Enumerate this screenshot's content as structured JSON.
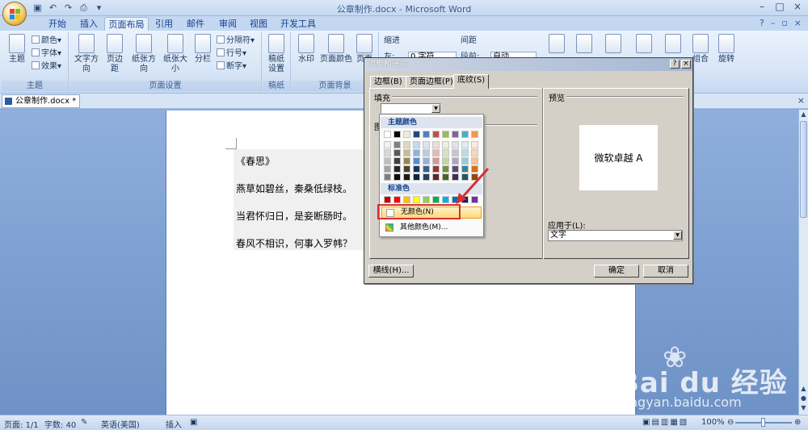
{
  "window": {
    "title": "公章制作.docx - Microsoft Word"
  },
  "ribbon_tabs": [
    "开始",
    "插入",
    "页面布局",
    "引用",
    "邮件",
    "审阅",
    "视图",
    "开发工具"
  ],
  "active_tab": "页面布局",
  "ribbon": {
    "theme": {
      "big": "主题",
      "items": [
        "颜色",
        "字体",
        "效果"
      ],
      "label": "主题"
    },
    "page_setup": {
      "big": [
        "文字方向",
        "页边距",
        "纸张方向",
        "纸张大小",
        "分栏"
      ],
      "items": [
        "分隔符",
        "行号",
        "断字"
      ],
      "label": "页面设置"
    },
    "paper": {
      "big": [
        "稿纸",
        "设置"
      ],
      "label": "稿纸"
    },
    "page_background": {
      "big": [
        "水印",
        "页面颜色",
        "页面"
      ],
      "label": "页面背景"
    },
    "paragraph": {
      "indent": "缩进",
      "spacing": "间距",
      "indent_left": "左:",
      "indent_value": "0 字符",
      "spacing_before": "段前:",
      "spacing_value": "自动"
    },
    "arrange": {
      "big": [
        "组合",
        "旋转"
      ]
    }
  },
  "document": {
    "tab_label": "公章制作.docx *",
    "lines": [
      "《春思》",
      "燕草如碧丝，秦桑低绿枝。",
      "当君怀归日，是妾断肠时。",
      "春风不相识，何事入罗帏？"
    ]
  },
  "dialog": {
    "title": "边框和底纹",
    "help": "?",
    "close": "×",
    "tabs": [
      "边框(B)",
      "页面边框(P)",
      "底纹(S)"
    ],
    "active_tab": "底纹(S)",
    "fill_label": "填充",
    "pattern_label": "图",
    "preview_label": "预览",
    "preview_text": "微软卓越  A",
    "apply_to_label": "应用于(L):",
    "apply_to_value": "文字",
    "horizontal_line_button": "横线(H)...",
    "ok_button": "确定",
    "cancel_button": "取消"
  },
  "color_dropdown": {
    "theme_colors_label": "主题颜色",
    "standard_colors_label": "标准色",
    "no_color": "无颜色(N)",
    "more_colors": "其他颜色(M)...",
    "theme_top_row": [
      "#ffffff",
      "#000000",
      "#eeece1",
      "#1f497d",
      "#4f81bd",
      "#c0504d",
      "#9bbb59",
      "#8064a2",
      "#4bacc6",
      "#f79646"
    ],
    "theme_shades": [
      [
        "#f2f2f2",
        "#7f7f7f",
        "#ddd9c3",
        "#c6d9f0",
        "#dbe5f1",
        "#f2dcdb",
        "#ebf1dd",
        "#e5e0ec",
        "#dbeef3",
        "#fdeada"
      ],
      [
        "#d8d8d8",
        "#595959",
        "#c4bd97",
        "#8db3e2",
        "#b8cce4",
        "#e5b9b7",
        "#d7e3bc",
        "#ccc1d9",
        "#b7dde8",
        "#fbd5b5"
      ],
      [
        "#bfbfbf",
        "#3f3f3f",
        "#938953",
        "#548dd4",
        "#95b3d7",
        "#d99694",
        "#c3d69b",
        "#b2a2c7",
        "#92cddc",
        "#fac08f"
      ],
      [
        "#a5a5a5",
        "#262626",
        "#494429",
        "#17365d",
        "#366092",
        "#953734",
        "#76923c",
        "#5f497a",
        "#31859b",
        "#e36c09"
      ],
      [
        "#7f7f7f",
        "#0c0c0c",
        "#1d1b10",
        "#0f243e",
        "#244061",
        "#632423",
        "#4f6128",
        "#3f3151",
        "#205867",
        "#974806"
      ]
    ],
    "standard": [
      "#c00000",
      "#ff0000",
      "#ffc000",
      "#ffff00",
      "#92d050",
      "#00b050",
      "#00b0f0",
      "#0070c0",
      "#002060",
      "#7030a0"
    ]
  },
  "statusbar": {
    "page": "页面: 1/1",
    "words": "字数: 40",
    "language": "英语(美国)",
    "mode": "插入",
    "zoom": "100%"
  },
  "watermark": {
    "brand": "Bai du 经验",
    "url": "jingyan.baidu.com"
  },
  "colors": {
    "highlight_red": "#d83030",
    "ribbon_bg": "#d6e4f6"
  }
}
